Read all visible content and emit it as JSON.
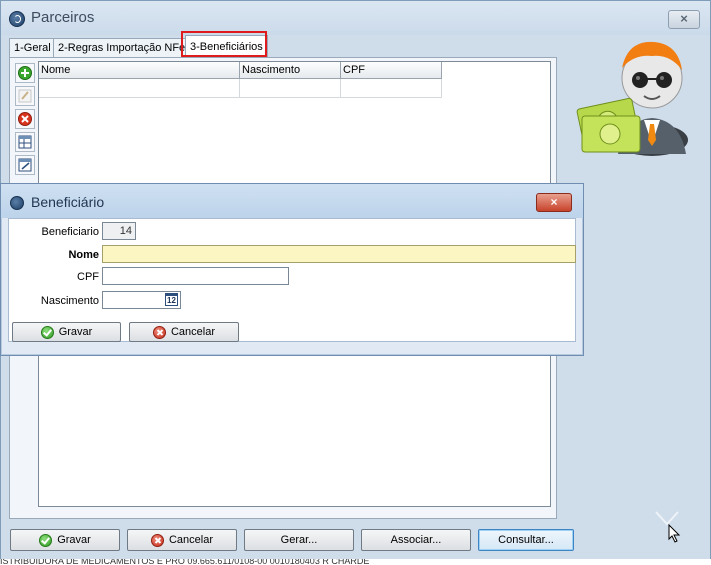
{
  "window": {
    "title": "Parceiros",
    "close_label": "×"
  },
  "tabs": [
    {
      "label": "1-Geral"
    },
    {
      "label": "2-Regras Importação NFe"
    },
    {
      "label": "3-Beneficiários"
    }
  ],
  "grid": {
    "columns": [
      "Nome",
      "Nascimento",
      "CPF"
    ]
  },
  "dialog": {
    "title": "Beneficiário",
    "close_label": "×",
    "fields": {
      "beneficiario_label": "Beneficiario",
      "beneficiario_value": "14",
      "nome_label": "Nome",
      "nome_value": "",
      "cpf_label": "CPF",
      "cpf_value": "",
      "nascimento_label": "Nascimento",
      "nascimento_value": "",
      "calendar_day": "12"
    },
    "buttons": {
      "save": "Gravar",
      "cancel": "Cancelar"
    }
  },
  "footer": {
    "save": "Gravar",
    "cancel": "Cancelar",
    "generate": "Gerar...",
    "associate": "Associar...",
    "query": "Consultar..."
  },
  "background_strip": "ISTRIBUIDORA DE MEDICAMENTOS E PRO    09.665.611/0108-00          0010180403          R CHARDE",
  "icons": {
    "add": "add-green-icon",
    "edit": "edit-icon",
    "delete": "delete-red-icon",
    "tool3": "table-icon",
    "tool4": "edit-list-icon"
  },
  "colors": {
    "highlight": "#e01b1b",
    "focus_field": "#fbf6c2",
    "dialog_close": "#c7432c"
  }
}
